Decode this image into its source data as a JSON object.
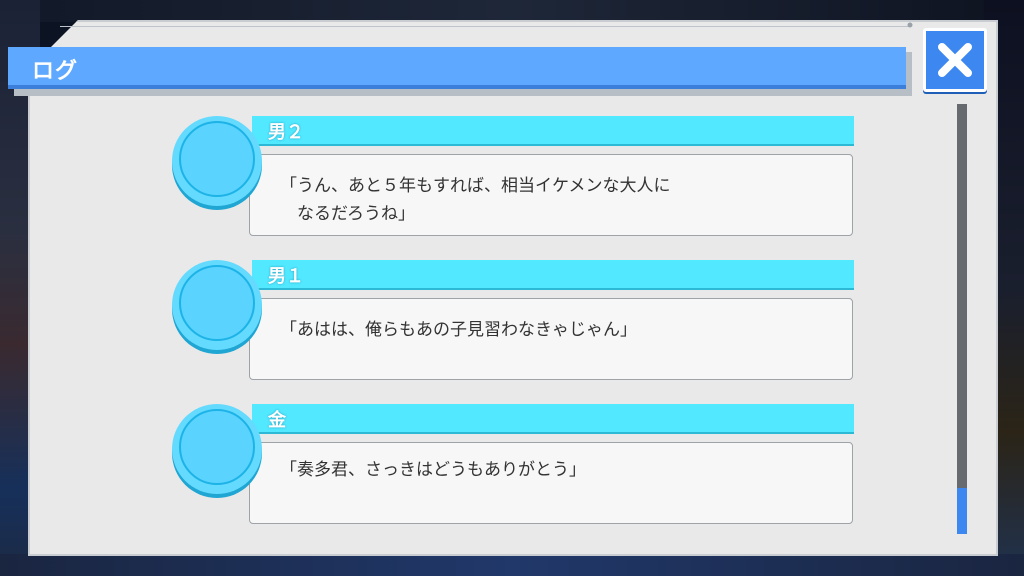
{
  "window": {
    "title": "ログ"
  },
  "close_button": {
    "icon": "close-icon",
    "color": "#3d87f0"
  },
  "colors": {
    "header": "#5ea8ff",
    "name_bar": "#52e8ff",
    "avatar": "#64daff",
    "panel": "#e9e9e9"
  },
  "log": {
    "entries": [
      {
        "speaker": "男２",
        "lines": [
          "「うん、あと５年もすれば、相当イケメンな大人に",
          "　なるだろうね」"
        ]
      },
      {
        "speaker": "男１",
        "lines": [
          "「あはは、俺らもあの子見習わなきゃじゃん」"
        ]
      },
      {
        "speaker": "金",
        "lines": [
          "「奏多君、さっきはどうもありがとう」"
        ]
      }
    ]
  }
}
